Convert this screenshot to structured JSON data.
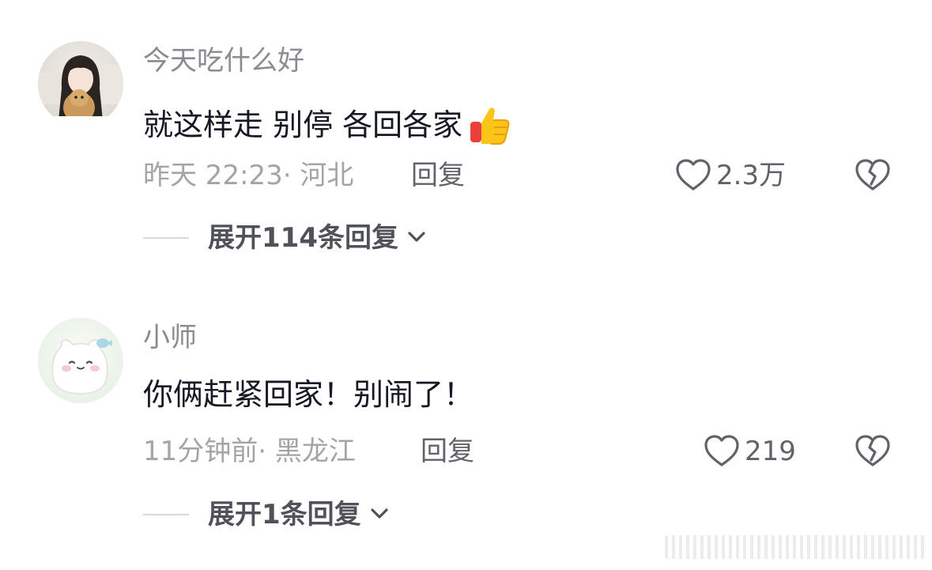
{
  "comments": [
    {
      "username": "今天吃什么好",
      "text": "就这样走 别停 各回各家",
      "emoji": "thumbs-up-icon",
      "time": "昨天 22:23",
      "location": "· 河北",
      "reply_label": "回复",
      "likes": "2.3万",
      "expand_label": "展开114条回复"
    },
    {
      "username": "小师",
      "text": "你俩赶紧回家！别闹了！",
      "time": "11分钟前",
      "location": "· 黑龙江",
      "reply_label": "回复",
      "likes": "219",
      "expand_label": "展开1条回复"
    }
  ],
  "colors": {
    "username": "#8a8b91",
    "body_text": "#161823",
    "meta": "#a3a4a8",
    "action": "#61626a"
  }
}
